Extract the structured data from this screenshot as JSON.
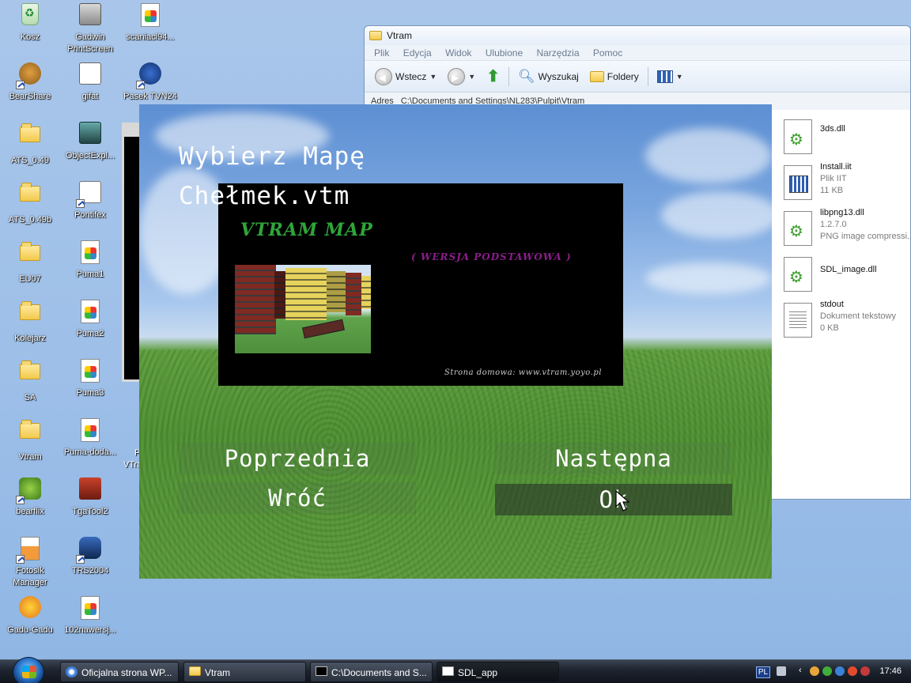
{
  "desktop": {
    "icons": [
      {
        "label": "Kosz",
        "icon": "recycle-bin-icon"
      },
      {
        "label": "Gadwin PrintScreen",
        "icon": "camera-icon"
      },
      {
        "label": "scaniacl94...",
        "icon": "image-file-icon"
      },
      {
        "label": "BearShare",
        "icon": "bear-icon"
      },
      {
        "label": "gifat",
        "icon": "gif-editor-icon"
      },
      {
        "label": "Pasek TVN24",
        "icon": "tvn-icon"
      },
      {
        "label": "ATS_0.49",
        "icon": "folder-icon"
      },
      {
        "label": "ObjectExpl...",
        "icon": "train-icon"
      },
      {
        "label": "ATS_0.49b",
        "icon": "folder-icon"
      },
      {
        "label": "Pontifex",
        "icon": "bridge-icon"
      },
      {
        "label": "EU07",
        "icon": "folder-icon"
      },
      {
        "label": "Puma1",
        "icon": "image-file-icon"
      },
      {
        "label": "Kolejarz",
        "icon": "folder-icon"
      },
      {
        "label": "Puma2",
        "icon": "image-file-icon"
      },
      {
        "label": "SA",
        "icon": "folder-icon"
      },
      {
        "label": "Puma3",
        "icon": "image-file-icon"
      },
      {
        "label": "Vtram",
        "icon": "folder-icon"
      },
      {
        "label": "Puma-doda...",
        "icon": "image-file-icon"
      },
      {
        "label": "bearflix",
        "icon": "bear-icon"
      },
      {
        "label": "TgaTool2",
        "icon": "tram-icon"
      },
      {
        "label": "Fotosik Manager",
        "icon": "fotosik-icon"
      },
      {
        "label": "TRS2004",
        "icon": "locomotive-icon"
      },
      {
        "label": "Gadu-Gadu",
        "icon": "sun-icon"
      },
      {
        "label": "102nawersj...",
        "icon": "image-file-icon"
      }
    ],
    "partial_labels": [
      "P",
      "VTra"
    ]
  },
  "explorer": {
    "title": "Vtram",
    "menu": [
      "Plik",
      "Edycja",
      "Widok",
      "Ulubione",
      "Narzędzia",
      "Pomoc"
    ],
    "toolbar": {
      "back_label": "Wstecz",
      "search_label": "Wyszukaj",
      "folders_label": "Foldery"
    },
    "address_label": "Adres",
    "address_value": "C:\\Documents and Settings\\NL283\\Pulpit\\Vtram",
    "files": [
      {
        "name": "3ds.dll",
        "line2": "",
        "line3": "",
        "kind": "dll"
      },
      {
        "name": "Install.iit",
        "line2": "Plik IIT",
        "line3": "11 KB",
        "kind": "ini"
      },
      {
        "name": "libpng13.dll",
        "line2": "1.2.7.0",
        "line3": "PNG image compressi...",
        "kind": "dll"
      },
      {
        "name": "SDL_image.dll",
        "line2": "",
        "line3": "",
        "kind": "dll"
      },
      {
        "name": "stdout",
        "line2": "Dokument tekstowy",
        "line3": "0 KB",
        "kind": "txt"
      }
    ]
  },
  "sdl_app": {
    "heading": "Wybierz Mapę",
    "map_name": "Chełmek.vtm",
    "preview": {
      "title": "VTRAM MAP",
      "subtitle": "( WERSJA PODSTAWOWA )",
      "homepage": "Strona domowa: www.vtram.yoyo.pl"
    },
    "buttons": {
      "previous": "Poprzednia",
      "next": "Następna",
      "back": "Wróć",
      "ok": "Ok"
    },
    "selected_button": "ok"
  },
  "taskbar": {
    "items": [
      {
        "label": "Oficjalna strona WP...",
        "icon": "ie-icon"
      },
      {
        "label": "Vtram",
        "icon": "folder-icon"
      },
      {
        "label": "C:\\Documents and S...",
        "icon": "console-icon"
      },
      {
        "label": "SDL_app",
        "icon": "window-icon"
      }
    ],
    "language": "PL",
    "clock": "17:46"
  }
}
